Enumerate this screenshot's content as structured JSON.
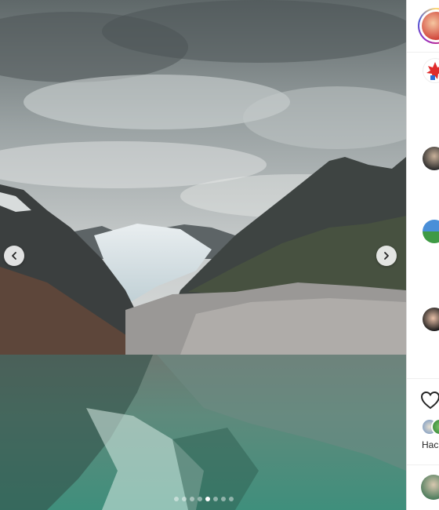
{
  "post": {
    "carousel_total": 8,
    "carousel_active_index": 4
  },
  "sidebar": {
    "liked_by_text": "Нас"
  },
  "icons": {
    "prev": "chevron-left-icon",
    "next": "chevron-right-icon",
    "like": "heart-icon"
  },
  "colors": {
    "divider": "#dbdbdb",
    "text": "#262626"
  }
}
